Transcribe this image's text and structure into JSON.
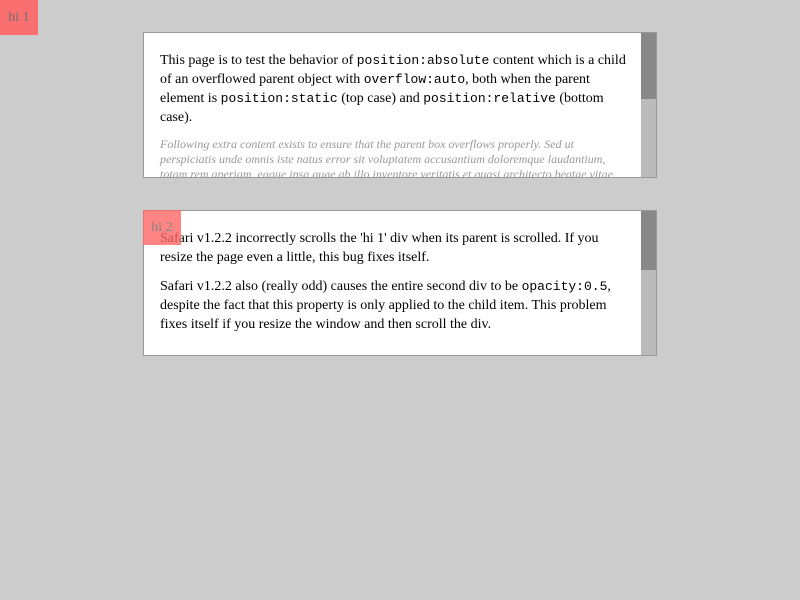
{
  "badges": {
    "first": "hi 1",
    "second": "hi 2"
  },
  "box1": {
    "p1": {
      "t1": "This page is to test the behavior of ",
      "c1": "position:absolute",
      "t2": " content which is a child of an overflowed parent object with ",
      "c2": "overflow:auto",
      "t3": ", both when the parent element is ",
      "c3": "position:static",
      "t4": " (top case) and ",
      "c4": "position:relative",
      "t5": " (bottom case)."
    },
    "extra": "Following extra content exists to ensure that the parent box overflows properly. Sed ut perspiciatis unde omnis iste natus error sit voluptatem accusantium doloremque laudantium, totam rem aperiam, eaque ipsa quae ab illo inventore veritatis et quasi architecto beatae vitae dicta sunt explicabo."
  },
  "box2": {
    "p1": "Safari v1.2.2 incorrectly scrolls the 'hi 1' div when its parent is scrolled. If you resize the page even a little, this bug fixes itself.",
    "p2": {
      "t1": "Safari v1.2.2 also (really odd) causes the entire second div to be ",
      "c1": "opacity:0.5",
      "t2": ", despite the fact that this property is only applied to the child item. This problem fixes itself if you resize the window and then scroll the div."
    }
  },
  "colors": {
    "page_bg": "#cccccc",
    "badge_bg": "#ff6666",
    "scroll_track": "#bbbbbb",
    "scroll_thumb": "#888888"
  }
}
